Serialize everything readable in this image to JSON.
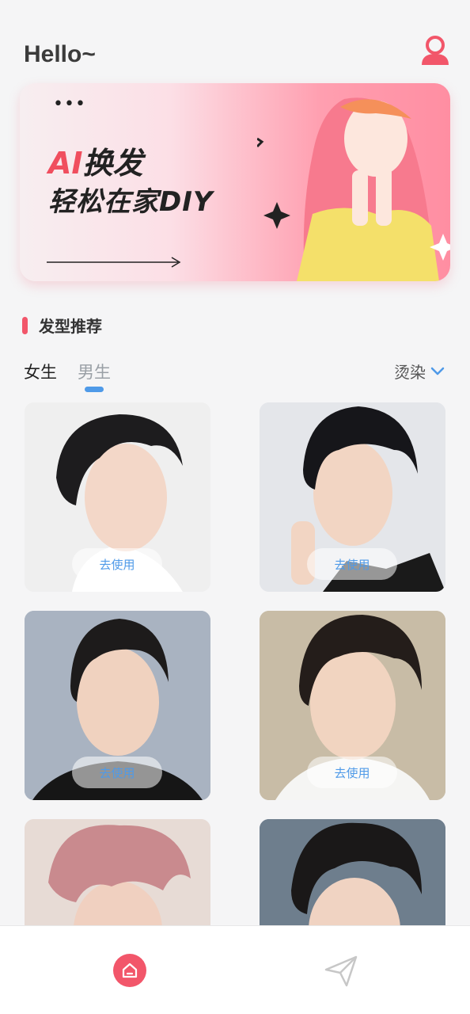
{
  "header": {
    "greeting": "Hello~",
    "user_icon": "user-icon"
  },
  "banner": {
    "menu": "•••",
    "title_ai": "AI",
    "title_rest": "换发",
    "subtitle": "轻松在家DIY"
  },
  "section": {
    "title": "发型推荐"
  },
  "tabs": [
    {
      "label": "女生",
      "active": false
    },
    {
      "label": "男生",
      "active": true
    }
  ],
  "filter": {
    "label": "烫染",
    "icon": "chevron-down-icon"
  },
  "cards": [
    {
      "button": "去使用"
    },
    {
      "button": "去使用"
    },
    {
      "button": "去使用"
    },
    {
      "button": "去使用"
    },
    {
      "button": ""
    },
    {
      "button": ""
    }
  ],
  "nav": [
    {
      "icon": "home-icon",
      "active": true
    },
    {
      "icon": "send-icon",
      "active": false
    }
  ],
  "colors": {
    "accent": "#f2566a",
    "blue": "#4f9ae8",
    "background": "#f5f5f6"
  }
}
